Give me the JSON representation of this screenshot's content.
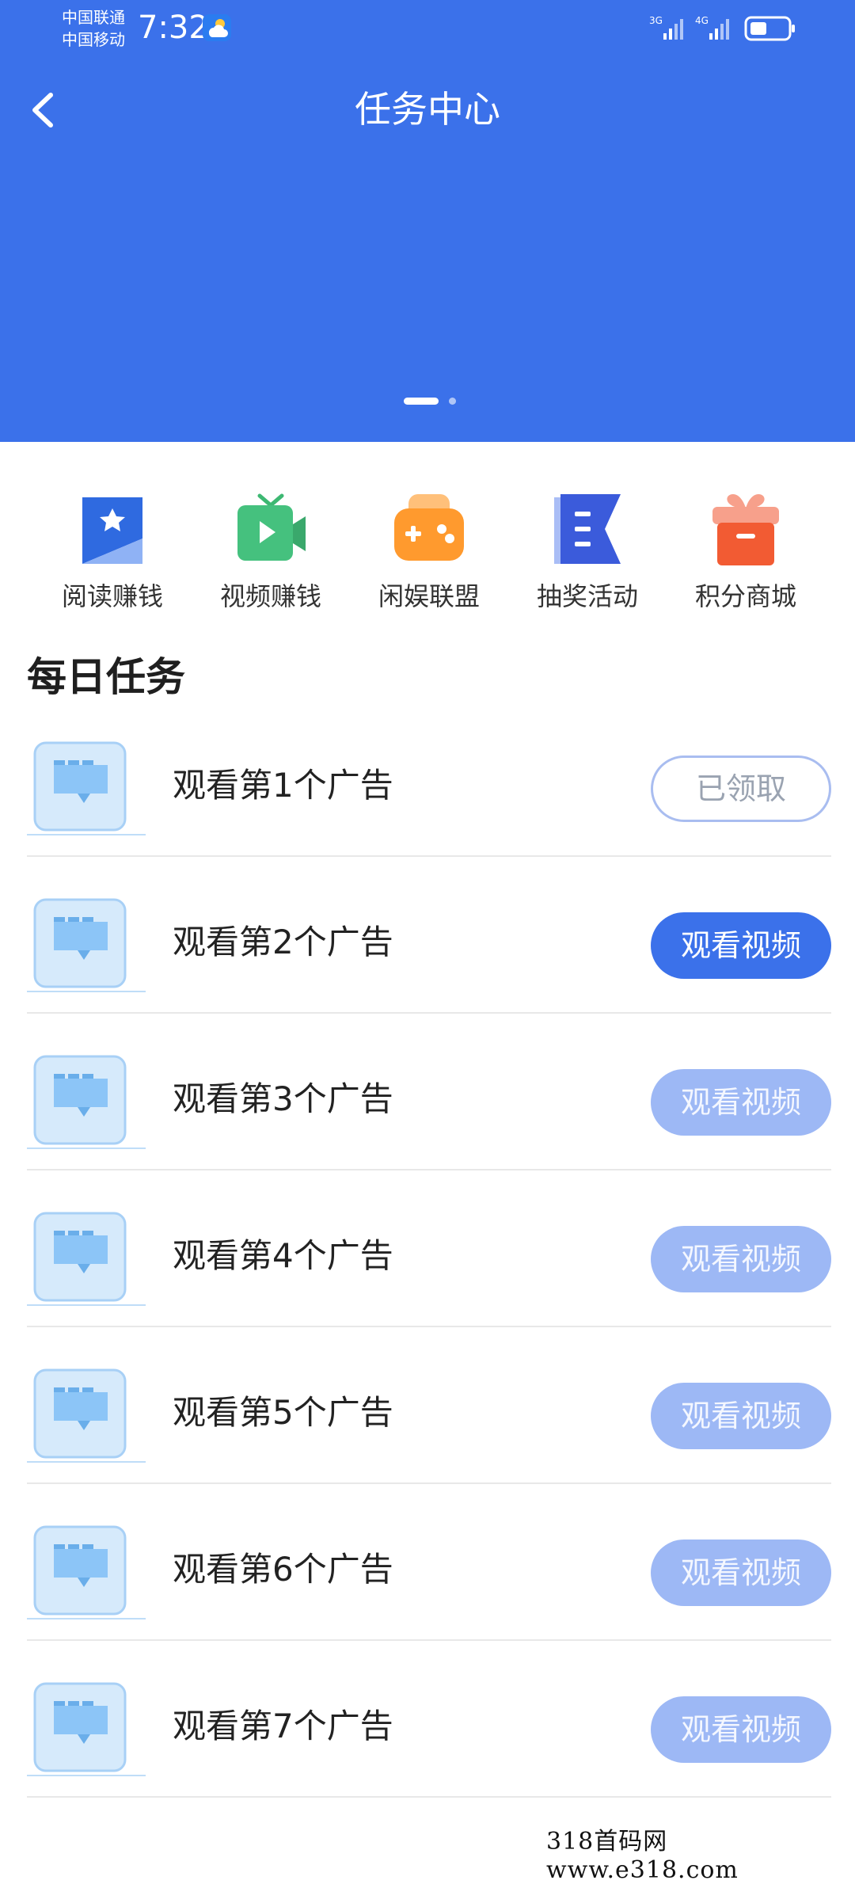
{
  "status_bar": {
    "carrier1": "中国联通",
    "carrier2": "中国移动",
    "time": "7:32",
    "signal1": "3G",
    "signal2": "4G"
  },
  "header": {
    "title": "任务中心"
  },
  "colors": {
    "brand": "#3B71EA",
    "button_pending": "#9DB8F5"
  },
  "quick_actions": [
    {
      "label": "阅读赚钱",
      "icon": "read-bookmark-icon"
    },
    {
      "label": "视频赚钱",
      "icon": "video-tv-icon"
    },
    {
      "label": "闲娱联盟",
      "icon": "game-controller-icon"
    },
    {
      "label": "抽奖活动",
      "icon": "lottery-flag-icon"
    },
    {
      "label": "积分商城",
      "icon": "gift-box-icon"
    }
  ],
  "daily": {
    "title": "每日任务",
    "tasks": [
      {
        "title": "观看第1个广告",
        "button": "已领取",
        "state": "done"
      },
      {
        "title": "观看第2个广告",
        "button": "观看视频",
        "state": "active"
      },
      {
        "title": "观看第3个广告",
        "button": "观看视频",
        "state": "pending"
      },
      {
        "title": "观看第4个广告",
        "button": "观看视频",
        "state": "pending"
      },
      {
        "title": "观看第5个广告",
        "button": "观看视频",
        "state": "pending"
      },
      {
        "title": "观看第6个广告",
        "button": "观看视频",
        "state": "pending"
      },
      {
        "title": "观看第7个广告",
        "button": "观看视频",
        "state": "pending"
      }
    ]
  },
  "watermark": "318首码网 www.e318.com"
}
